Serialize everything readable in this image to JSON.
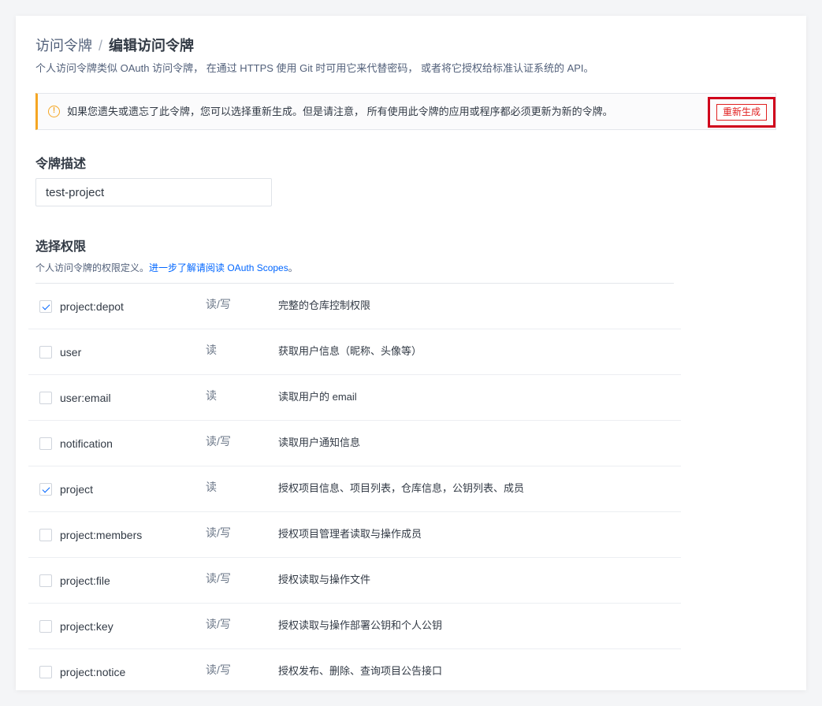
{
  "breadcrumb": {
    "parent": "访问令牌",
    "separator": "/",
    "current": "编辑访问令牌"
  },
  "subtitle": "个人访问令牌类似 OAuth 访问令牌， 在通过 HTTPS 使用 Git 时可用它来代替密码， 或者将它授权给标准认证系统的 API。",
  "alert": {
    "icon": "warning-circle-icon",
    "icon_glyph": "!",
    "text": "如果您遗失或遗忘了此令牌，您可以选择重新生成。但是请注意， 所有使用此令牌的应用或程序都必须更新为新的令牌。",
    "regenerate_label": "重新生成",
    "accent_color": "#f5a623",
    "button_color": "#e02020",
    "highlight_color": "#d0021b"
  },
  "token_description": {
    "title": "令牌描述",
    "value": "test-project"
  },
  "permissions": {
    "title": "选择权限",
    "subtitle": "个人访问令牌的权限定义。",
    "link_text": "进一步了解请阅读 OAuth Scopes",
    "subtitle_end": "。",
    "link_color": "#0066ff",
    "scopes": [
      {
        "name": "project:depot",
        "access": "读/写",
        "description": "完整的仓库控制权限",
        "checked": true
      },
      {
        "name": "user",
        "access": "读",
        "description": "获取用户信息（昵称、头像等）",
        "checked": false
      },
      {
        "name": "user:email",
        "access": "读",
        "description": "读取用户的 email",
        "checked": false
      },
      {
        "name": "notification",
        "access": "读/写",
        "description": "读取用户通知信息",
        "checked": false
      },
      {
        "name": "project",
        "access": "读",
        "description": "授权项目信息、项目列表，仓库信息，公钥列表、成员",
        "checked": true
      },
      {
        "name": "project:members",
        "access": "读/写",
        "description": "授权项目管理者读取与操作成员",
        "checked": false
      },
      {
        "name": "project:file",
        "access": "读/写",
        "description": "授权读取与操作文件",
        "checked": false
      },
      {
        "name": "project:key",
        "access": "读/写",
        "description": "授权读取与操作部署公钥和个人公钥",
        "checked": false
      },
      {
        "name": "project:notice",
        "access": "读/写",
        "description": "授权发布、删除、查询项目公告接口",
        "checked": false
      }
    ]
  }
}
